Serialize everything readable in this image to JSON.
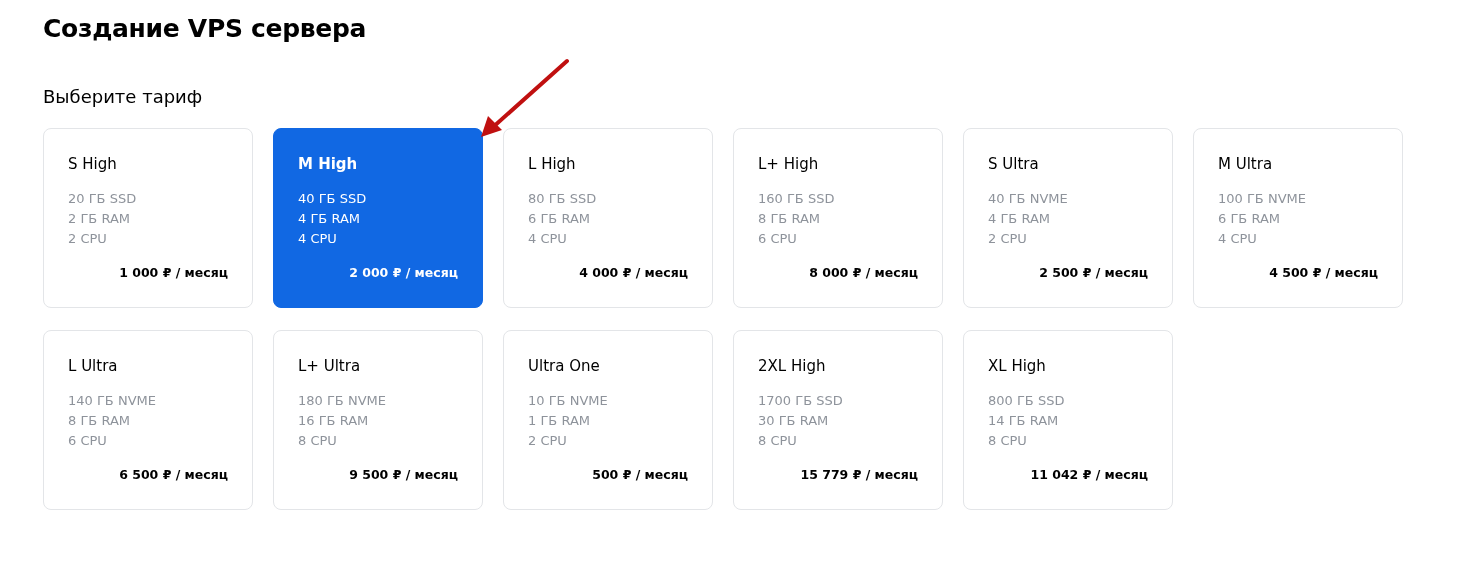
{
  "title": "Создание VPS сервера",
  "subtitle": "Выберите тариф",
  "plans": [
    {
      "name": "S High",
      "specs": [
        "20 ГБ SSD",
        "2 ГБ RAM",
        "2 CPU"
      ],
      "price": "1 000 ₽ / месяц",
      "selected": false
    },
    {
      "name": "M High",
      "specs": [
        "40 ГБ SSD",
        "4 ГБ RAM",
        "4 CPU"
      ],
      "price": "2 000 ₽ / месяц",
      "selected": true
    },
    {
      "name": "L High",
      "specs": [
        "80 ГБ SSD",
        "6 ГБ RAM",
        "4 CPU"
      ],
      "price": "4 000 ₽ / месяц",
      "selected": false
    },
    {
      "name": "L+ High",
      "specs": [
        "160 ГБ SSD",
        "8 ГБ RAM",
        "6 CPU"
      ],
      "price": "8 000 ₽ / месяц",
      "selected": false
    },
    {
      "name": "S Ultra",
      "specs": [
        "40 ГБ NVME",
        "4 ГБ RAM",
        "2 CPU"
      ],
      "price": "2 500 ₽ / месяц",
      "selected": false
    },
    {
      "name": "M Ultra",
      "specs": [
        "100 ГБ NVME",
        "6 ГБ RAM",
        "4 CPU"
      ],
      "price": "4 500 ₽ / месяц",
      "selected": false
    },
    {
      "name": "L Ultra",
      "specs": [
        "140 ГБ NVME",
        "8 ГБ RAM",
        "6 CPU"
      ],
      "price": "6 500 ₽ / месяц",
      "selected": false
    },
    {
      "name": "L+ Ultra",
      "specs": [
        "180 ГБ NVME",
        "16 ГБ RAM",
        "8 CPU"
      ],
      "price": "9 500 ₽ / месяц",
      "selected": false
    },
    {
      "name": "Ultra One",
      "specs": [
        "10 ГБ NVME",
        "1 ГБ RAM",
        "2 CPU"
      ],
      "price": "500 ₽ / месяц",
      "selected": false
    },
    {
      "name": "2XL High",
      "specs": [
        "1700 ГБ SSD",
        "30 ГБ RAM",
        "8 CPU"
      ],
      "price": "15 779 ₽ / месяц",
      "selected": false
    },
    {
      "name": "XL High",
      "specs": [
        "800 ГБ SSD",
        "14 ГБ RAM",
        "8 CPU"
      ],
      "price": "11 042 ₽ / месяц",
      "selected": false
    }
  ]
}
